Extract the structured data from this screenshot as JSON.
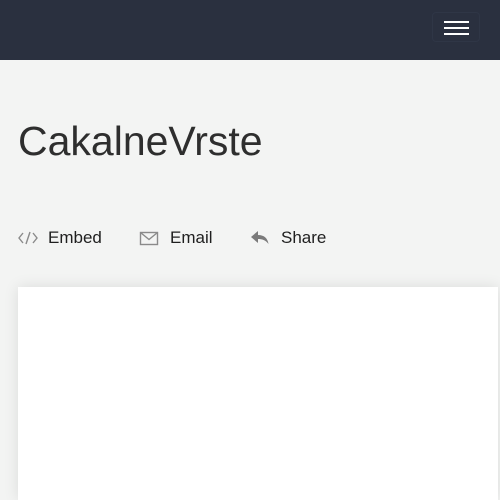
{
  "header": {
    "menu_icon": "hamburger-menu-icon",
    "background": "#2a303f"
  },
  "page": {
    "title": "CakalneVrste"
  },
  "actions": [
    {
      "label": "Embed",
      "icon": "code-icon"
    },
    {
      "label": "Email",
      "icon": "envelope-icon"
    },
    {
      "label": "Share",
      "icon": "share-reply-icon"
    }
  ],
  "colors": {
    "page_background": "#f3f4f3",
    "icon_gray": "#8a8a8a",
    "text_dark": "#2e2e2e"
  }
}
